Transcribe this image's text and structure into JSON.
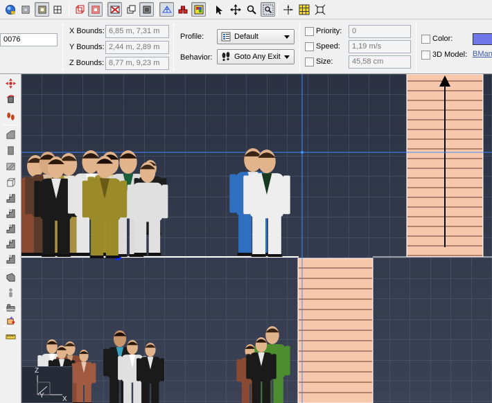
{
  "toolbar": {
    "buttons": [
      {
        "id": "app-menu",
        "icon": "globe-orb-icon"
      },
      {
        "id": "view-1",
        "icon": "single-view-icon"
      },
      {
        "id": "view-2",
        "icon": "split-view-icon",
        "pressed": true
      },
      {
        "id": "view-3",
        "icon": "quad-view-icon"
      },
      {
        "id": "wire-1",
        "icon": "wire-box-icon"
      },
      {
        "id": "wire-2",
        "icon": "wire-box-red-icon",
        "pressed": true
      },
      {
        "id": "obstacle",
        "icon": "obstacle-icon",
        "pressed": true
      },
      {
        "id": "shade-1",
        "icon": "shaded-box-icon"
      },
      {
        "id": "shade-2",
        "icon": "shaded-box-2-icon",
        "pressed": true
      },
      {
        "id": "navmesh",
        "icon": "navmesh-icon",
        "pressed": true
      },
      {
        "id": "cubes",
        "icon": "red-cubes-icon"
      },
      {
        "id": "colors",
        "icon": "color-cube-icon",
        "pressed": true
      },
      {
        "id": "select",
        "icon": "arrow-cursor-icon"
      },
      {
        "id": "move",
        "icon": "move-cross-icon"
      },
      {
        "id": "zoom",
        "icon": "magnifier-icon"
      },
      {
        "id": "zoom-region",
        "icon": "zoom-region-icon",
        "pressed": true
      },
      {
        "id": "snap-center",
        "icon": "crosshair-icon"
      },
      {
        "id": "grid-snap",
        "icon": "grid-snap-icon"
      },
      {
        "id": "fit",
        "icon": "fit-frame-icon"
      }
    ]
  },
  "props": {
    "id_value": "0076",
    "x_bounds_label": "X Bounds:",
    "x_bounds_value": "6,85 m, 7,31 m",
    "y_bounds_label": "Y Bounds:",
    "y_bounds_value": "2,44 m, 2,89 m",
    "z_bounds_label": "Z Bounds:",
    "z_bounds_value": "8,77 m, 9,23 m",
    "profile_label": "Profile:",
    "profile_value": "Default",
    "behavior_label": "Behavior:",
    "behavior_value": "Goto Any Exit",
    "priority_label": "Priority:",
    "priority_value": "0",
    "speed_label": "Speed:",
    "speed_value": "1,19 m/s",
    "size_label": "Size:",
    "size_value": "45,58 cm",
    "color_label": "Color:",
    "color_swatch": "#6f78e8",
    "model_label": "3D Model:",
    "model_value": "BMan("
  },
  "palette": {
    "tools": [
      "move-tool-icon",
      "rotate-tool-icon",
      "footsteps-icon",
      "wall-tool-icon",
      "block-tool-icon",
      "hatch-tool-icon",
      "box-outline-icon",
      "stairs-1-icon",
      "stairs-2-icon",
      "stairs-3-icon",
      "stairs-4-icon",
      "stairs-5-icon",
      "ramp-tool-icon",
      "figure-tool-icon",
      "bench-tool-icon",
      "paint-tool-icon",
      "ruler-tool-icon"
    ]
  },
  "viewport": {
    "background": "#2e3547",
    "floor_color": "#f8c8ad",
    "axes": {
      "z": "Z",
      "y": "Y",
      "x": "X"
    }
  }
}
